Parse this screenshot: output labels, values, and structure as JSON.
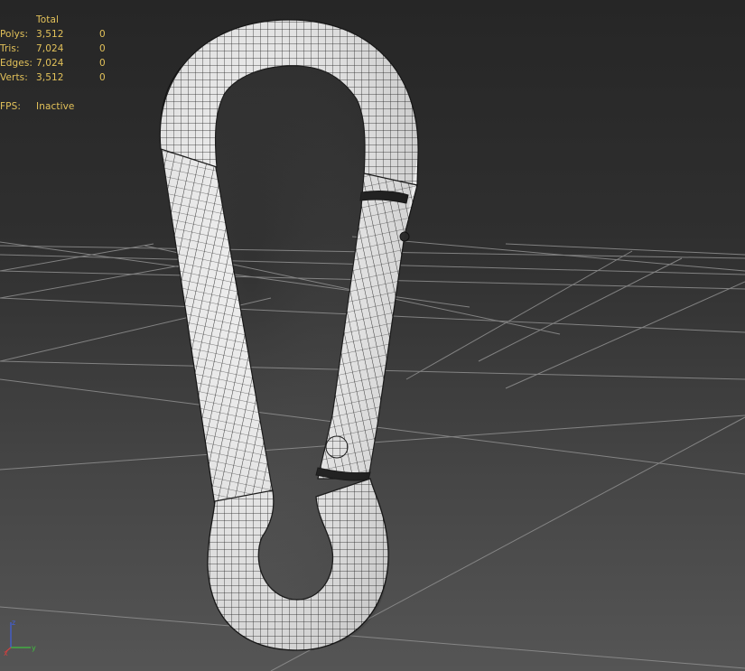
{
  "viewport": {
    "background_top": "#262626",
    "background_bottom": "#555555",
    "grid_color": "#8f8f8f",
    "wireframe_fill": "#ececec",
    "wireframe_line": "#1c1c1c"
  },
  "stats": {
    "header": "Total",
    "text_color": "#e3c25a",
    "rows": [
      {
        "label": "Polys:",
        "total": "3,512",
        "selected": "0"
      },
      {
        "label": "Tris:",
        "total": "7,024",
        "selected": "0"
      },
      {
        "label": "Edges:",
        "total": "7,024",
        "selected": "0"
      },
      {
        "label": "Verts:",
        "total": "3,512",
        "selected": "0"
      }
    ],
    "fps_label": "FPS:",
    "fps_value": "Inactive"
  },
  "axis_tripod": {
    "x_label": "x",
    "y_label": "y",
    "z_label": "z",
    "x_color": "#d04040",
    "y_color": "#40c040",
    "z_color": "#4060e0"
  },
  "model": {
    "icon": "carabiner-snap-hook-wireframe"
  }
}
